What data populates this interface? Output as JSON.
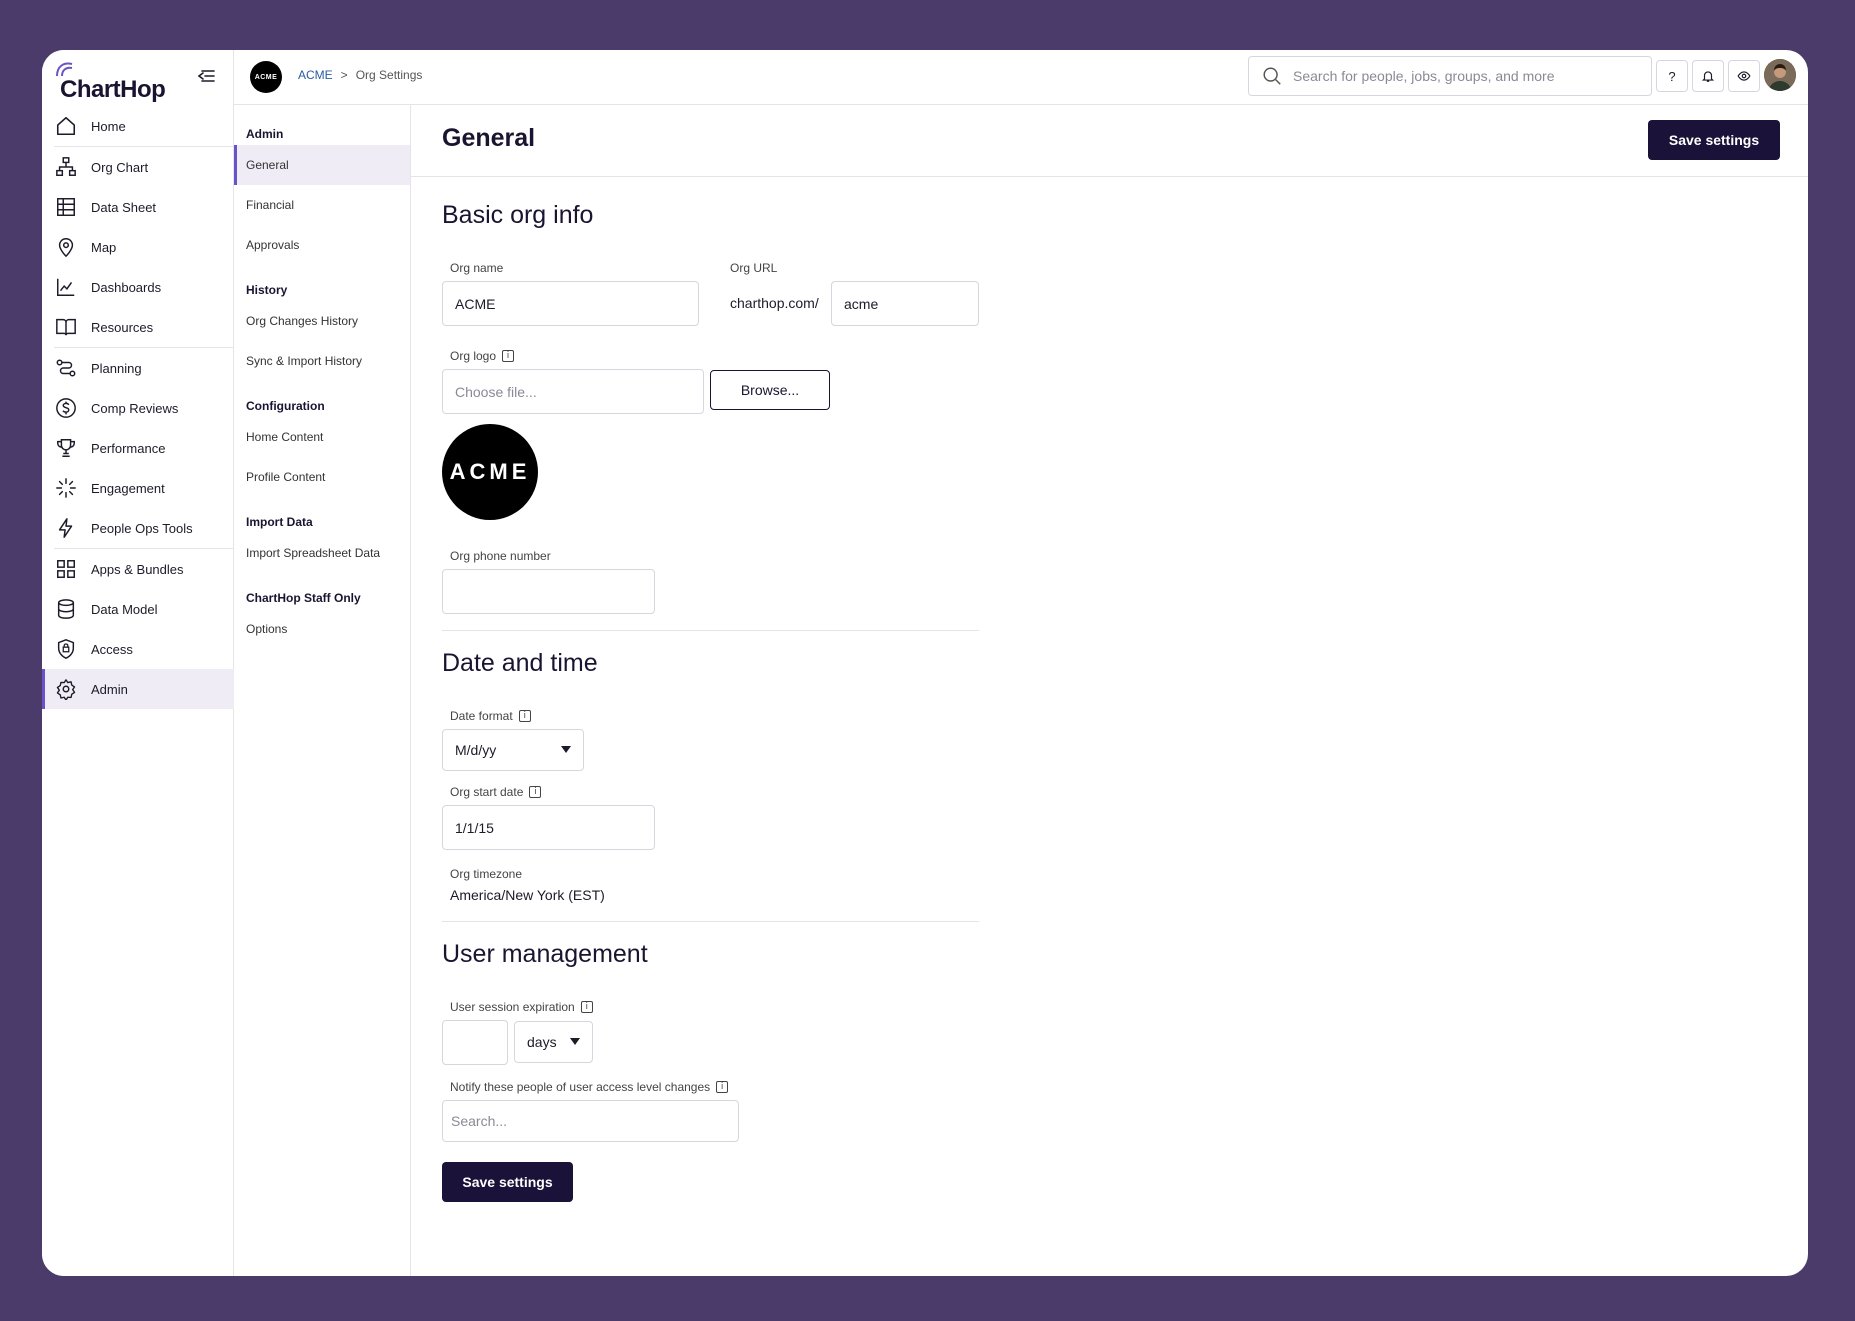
{
  "app": {
    "brand": "ChartHop",
    "org_avatar_text": "ACME"
  },
  "sidebar": {
    "items": [
      {
        "label": "Home",
        "icon": "home-icon"
      },
      {
        "label": "Org Chart",
        "icon": "org-chart-icon"
      },
      {
        "label": "Data Sheet",
        "icon": "data-sheet-icon"
      },
      {
        "label": "Map",
        "icon": "map-pin-icon"
      },
      {
        "label": "Dashboards",
        "icon": "dashboard-icon"
      },
      {
        "label": "Resources",
        "icon": "book-icon"
      },
      {
        "label": "Planning",
        "icon": "planning-icon"
      },
      {
        "label": "Comp Reviews",
        "icon": "dollar-icon"
      },
      {
        "label": "Performance",
        "icon": "trophy-icon"
      },
      {
        "label": "Engagement",
        "icon": "sparkle-icon"
      },
      {
        "label": "People Ops Tools",
        "icon": "lightning-icon"
      },
      {
        "label": "Apps & Bundles",
        "icon": "apps-icon"
      },
      {
        "label": "Data Model",
        "icon": "database-icon"
      },
      {
        "label": "Access",
        "icon": "shield-icon"
      },
      {
        "label": "Admin",
        "icon": "gear-icon"
      }
    ],
    "active": "Admin"
  },
  "topbar": {
    "breadcrumb": [
      "ACME",
      ">",
      "Org Settings"
    ],
    "search_placeholder": "Search for people, jobs, groups, and more",
    "help_label": "?"
  },
  "subnav": {
    "groups": [
      {
        "heading": "Admin",
        "items": [
          "General",
          "Financial",
          "Approvals"
        ]
      },
      {
        "heading": "History",
        "items": [
          "Org Changes History",
          "Sync & Import History"
        ]
      },
      {
        "heading": "Configuration",
        "items": [
          "Home Content",
          "Profile Content"
        ]
      },
      {
        "heading": "Import Data",
        "items": [
          "Import Spreadsheet Data"
        ]
      },
      {
        "heading": "ChartHop Staff Only",
        "items": [
          "Options"
        ]
      }
    ],
    "active": "General"
  },
  "main": {
    "title": "General",
    "save_label": "Save settings",
    "basic": {
      "title": "Basic org info",
      "org_name_label": "Org name",
      "org_name_value": "ACME",
      "org_url_label": "Org URL",
      "org_url_prefix": "charthop.com/",
      "org_url_value": "acme",
      "org_logo_label": "Org logo",
      "org_logo_placeholder": "Choose file...",
      "browse_label": "Browse...",
      "logo_text": "ACME",
      "phone_label": "Org phone number",
      "phone_value": ""
    },
    "datetime": {
      "title": "Date and time",
      "date_format_label": "Date format",
      "date_format_value": "M/d/yy",
      "start_date_label": "Org start date",
      "start_date_value": "1/1/15",
      "timezone_label": "Org timezone",
      "timezone_value": "America/New York (EST)"
    },
    "users": {
      "title": "User management",
      "session_label": "User session expiration",
      "session_value": "",
      "session_unit": "days",
      "notify_label": "Notify these people of user access level changes",
      "notify_placeholder": "Search..."
    }
  },
  "colors": {
    "accent": "#6a52c8",
    "primary_button": "#1a1238",
    "background": "#4b3b6b"
  }
}
